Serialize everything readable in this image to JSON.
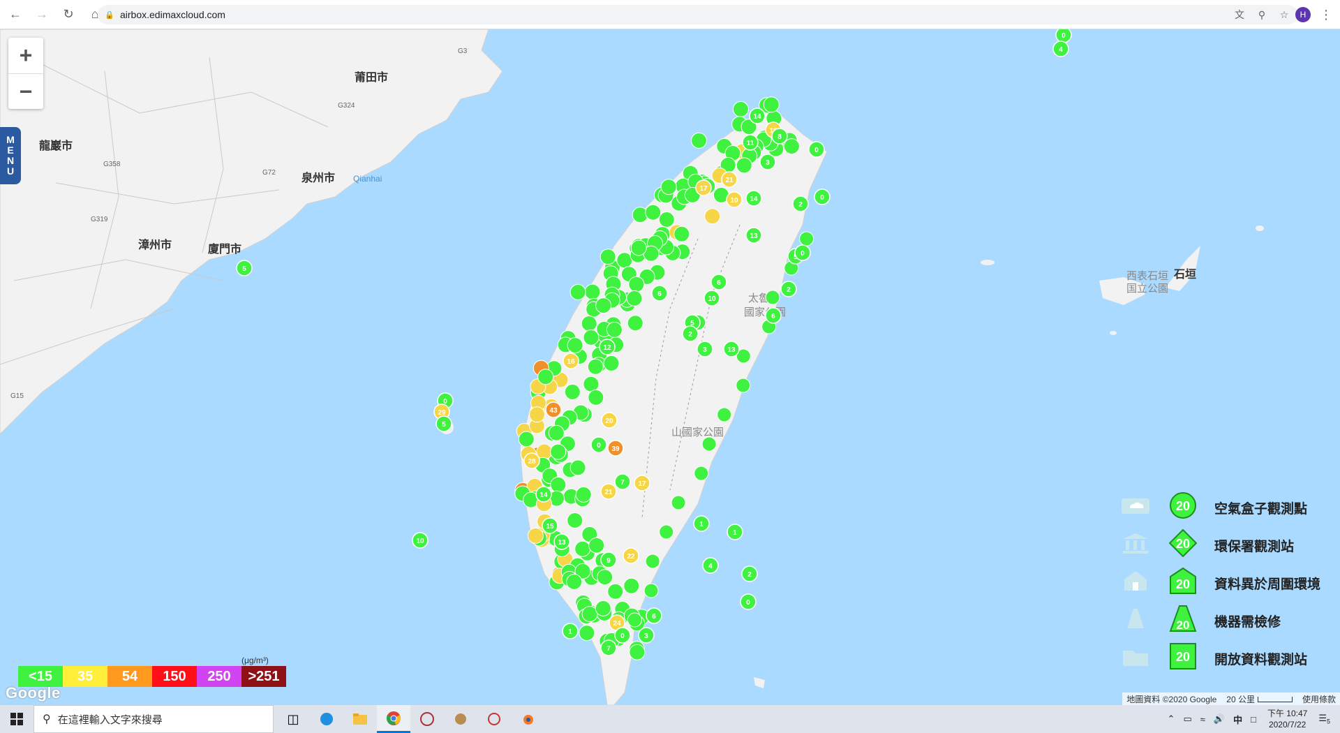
{
  "browser": {
    "url": "airbox.edimaxcloud.com",
    "profile_initial": "H"
  },
  "map": {
    "zoom_in": "+",
    "zoom_out": "−",
    "menu_label": [
      "M",
      "E",
      "N",
      "U"
    ],
    "place_labels": [
      {
        "text": "莆田市",
        "cls": "city"
      },
      {
        "text": "泉州市",
        "cls": "city"
      },
      {
        "text": "漳州市",
        "cls": "city"
      },
      {
        "text": "廈門市",
        "cls": "city"
      },
      {
        "text": "龍巖市",
        "cls": "city"
      },
      {
        "text": "Qianhai",
        "cls": "water"
      },
      {
        "text": "太魯閣",
        "cls": "park"
      },
      {
        "text": "國家公園",
        "cls": "park"
      },
      {
        "text": "山國家公園",
        "cls": "park"
      },
      {
        "text": "西表石垣",
        "cls": "park"
      },
      {
        "text": "国立公園",
        "cls": "park"
      },
      {
        "text": "石垣",
        "cls": "city"
      },
      {
        "text": "G3",
        "cls": "road"
      },
      {
        "text": "G324",
        "cls": "road"
      },
      {
        "text": "G358",
        "cls": "road"
      },
      {
        "text": "G72",
        "cls": "road"
      },
      {
        "text": "G319",
        "cls": "road"
      },
      {
        "text": "G15",
        "cls": "road"
      }
    ],
    "markers": [
      {
        "v": "0",
        "c": "g"
      },
      {
        "v": "4",
        "c": "g"
      },
      {
        "v": "5",
        "c": "g"
      },
      {
        "v": "14",
        "c": "g"
      },
      {
        "v": "19",
        "c": "y"
      },
      {
        "v": "8",
        "c": "g"
      },
      {
        "v": "3",
        "c": "g"
      },
      {
        "v": "11",
        "c": "g"
      },
      {
        "v": "0",
        "c": "g"
      },
      {
        "v": "21",
        "c": "y"
      },
      {
        "v": "17",
        "c": "y"
      },
      {
        "v": "10",
        "c": "y"
      },
      {
        "v": "14",
        "c": "g"
      },
      {
        "v": "2",
        "c": "g"
      },
      {
        "v": "0",
        "c": "g"
      },
      {
        "v": "13",
        "c": "g"
      },
      {
        "v": "5",
        "c": "g"
      },
      {
        "v": "0",
        "c": "g"
      },
      {
        "v": "6",
        "c": "g"
      },
      {
        "v": "2",
        "c": "g"
      },
      {
        "v": "10",
        "c": "g"
      },
      {
        "v": "6",
        "c": "g"
      },
      {
        "v": "2",
        "c": "g"
      },
      {
        "v": "5",
        "c": "g"
      },
      {
        "v": "2",
        "c": "g"
      },
      {
        "v": "6",
        "c": "g"
      },
      {
        "v": "3",
        "c": "g"
      },
      {
        "v": "13",
        "c": "g"
      },
      {
        "v": "16",
        "c": "y"
      },
      {
        "v": "12",
        "c": "g"
      },
      {
        "v": "43",
        "c": "o"
      },
      {
        "v": "20",
        "c": "y"
      },
      {
        "v": "39",
        "c": "o"
      },
      {
        "v": "0",
        "c": "g"
      },
      {
        "v": "7",
        "c": "g"
      },
      {
        "v": "17",
        "c": "y"
      },
      {
        "v": "21",
        "c": "y"
      },
      {
        "v": "28",
        "c": "y"
      },
      {
        "v": "14",
        "c": "g"
      },
      {
        "v": "15",
        "c": "g"
      },
      {
        "v": "13",
        "c": "g"
      },
      {
        "v": "9",
        "c": "g"
      },
      {
        "v": "22",
        "c": "y"
      },
      {
        "v": "24",
        "c": "y"
      },
      {
        "v": "1",
        "c": "g"
      },
      {
        "v": "7",
        "c": "g"
      },
      {
        "v": "0",
        "c": "g"
      },
      {
        "v": "2",
        "c": "g"
      },
      {
        "v": "1",
        "c": "g"
      },
      {
        "v": "10",
        "c": "g"
      },
      {
        "v": "0",
        "c": "g"
      },
      {
        "v": "29",
        "c": "y"
      },
      {
        "v": "5",
        "c": "g"
      },
      {
        "v": "6",
        "c": "g"
      },
      {
        "v": "3",
        "c": "g"
      },
      {
        "v": "1",
        "c": "g"
      },
      {
        "v": "0",
        "c": "g"
      },
      {
        "v": "4",
        "c": "g"
      }
    ]
  },
  "legend": [
    {
      "badge": "20",
      "label": "空氣盒子觀測點",
      "shape": "circle"
    },
    {
      "badge": "20",
      "label": "環保署觀測站",
      "shape": "diamond"
    },
    {
      "badge": "20",
      "label": "資料異於周圍環境",
      "shape": "house"
    },
    {
      "badge": "20",
      "label": "機器需檢修",
      "shape": "cone"
    },
    {
      "badge": "20",
      "label": "開放資料觀測站",
      "shape": "square"
    }
  ],
  "scale": {
    "unit": "(μg/m³)",
    "items": [
      {
        "label": "<15",
        "color": "#3ff23f"
      },
      {
        "label": "35",
        "color": "#ffef3a"
      },
      {
        "label": "54",
        "color": "#ff9a1f"
      },
      {
        "label": "150",
        "color": "#ff0f17"
      },
      {
        "label": "250",
        "color": "#d244f2"
      },
      {
        "label": ">251",
        "color": "#8f1117"
      }
    ]
  },
  "attribution": {
    "google": "Google",
    "map_data": "地圖資料 ©2020 Google",
    "scale_text": "20 公里",
    "terms": "使用條款"
  },
  "taskbar": {
    "search_placeholder": "在這裡輸入文字來搜尋",
    "ime": "中",
    "time": "下午 10:47",
    "date": "2020/7/22",
    "notif_count": "5"
  },
  "colors": {
    "green": "#3ff23f",
    "yellow": "#f6d547",
    "orange": "#f0902a",
    "red": "#e0101a",
    "sea": "#aadaff"
  }
}
